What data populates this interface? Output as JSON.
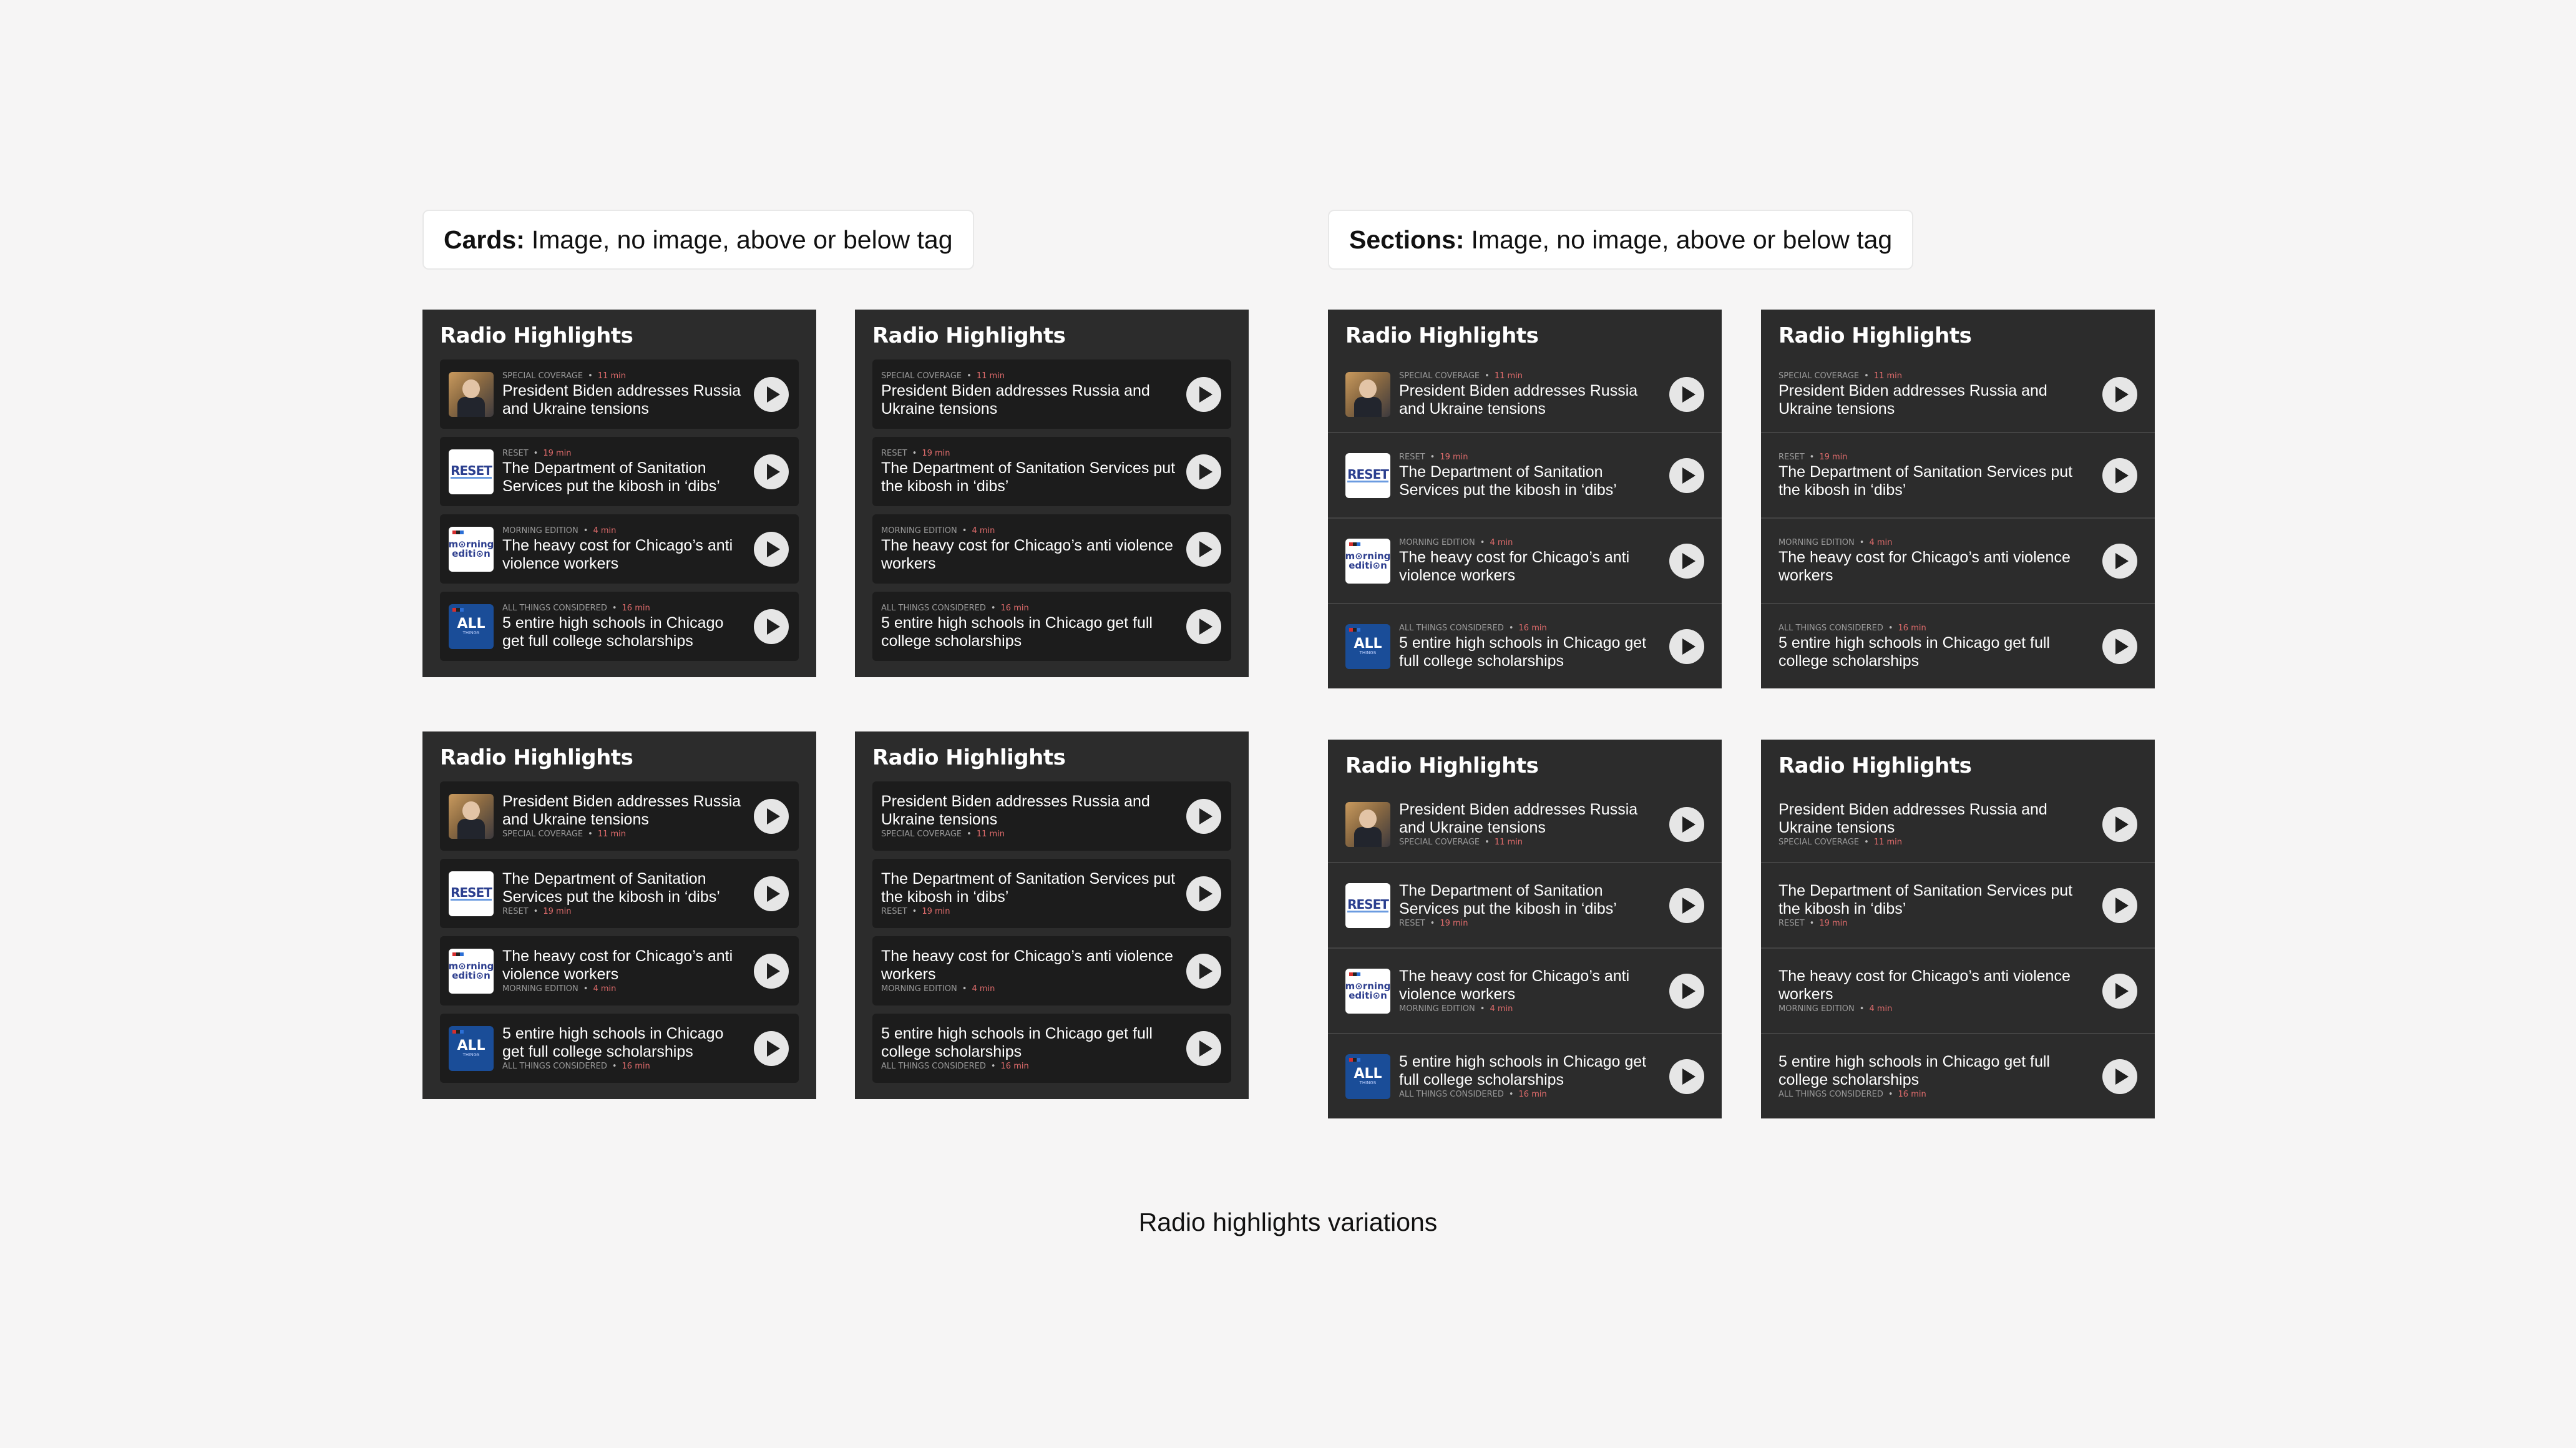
{
  "labels": {
    "cards_bold": "Cards:",
    "cards_rest": "Image, no image, above or below tag",
    "sections_bold": "Sections:",
    "sections_rest": "Image, no image, above or below tag",
    "caption": "Radio highlights variations"
  },
  "widget_title": "Radio Highlights",
  "separator": "•",
  "items": [
    {
      "program": "Special Coverage",
      "duration": "11 min",
      "headline": "President Biden addresses Russia and Ukraine tensions",
      "thumb_icon": "biden-photo"
    },
    {
      "program": "Reset",
      "duration": "19 min",
      "headline": "The Department of Sanitation Services put the kibosh in ‘dibs’",
      "thumb_icon": "reset-logo"
    },
    {
      "program": "Morning Edition",
      "duration": "4 min",
      "headline": "The heavy cost for Chicago’s anti violence workers",
      "thumb_icon": "morning-edition-logo"
    },
    {
      "program": "All Things Considered",
      "duration": "16 min",
      "headline": "5 entire high schools in Chicago get full college scholarships",
      "thumb_icon": "all-things-considered-logo"
    }
  ],
  "logos": {
    "reset": "RESET",
    "morning_1": "m⊙rning",
    "morning_2": "editi⊙n",
    "atc_1": "ALL",
    "atc_2": "THINGS"
  },
  "colors": {
    "background": "#f6f5f5",
    "widget": "#2c2c2c",
    "card": "#1c1c1c",
    "duration": "#e06c6c"
  }
}
